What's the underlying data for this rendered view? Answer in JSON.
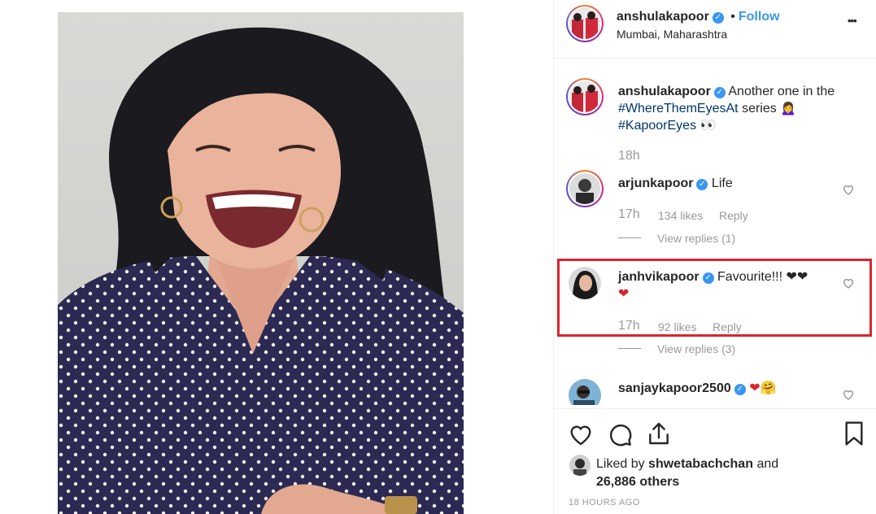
{
  "post": {
    "author": "anshulakapoor",
    "follow_label": "Follow",
    "separator": "•",
    "location": "Mumbai, Maharashtra",
    "more_label": "•••"
  },
  "caption": {
    "username": "anshulakapoor",
    "text_before": "Another one in the",
    "hashtag1": "#WhereThemEyesAt",
    "text_mid": "series 🙍‍♀️",
    "hashtag2": "#KapoorEyes",
    "text_after": "👀",
    "time": "18h"
  },
  "comments": [
    {
      "username": "arjunkapoor",
      "text": "Life",
      "time": "17h",
      "likes": "134 likes",
      "reply": "Reply",
      "view_replies": "View replies (1)"
    },
    {
      "username": "janhvikapoor",
      "text": "Favourite!!! ❤❤",
      "text2": "❤",
      "time": "17h",
      "likes": "92 likes",
      "reply": "Reply",
      "view_replies": "View replies (3)"
    },
    {
      "username": "sanjaykapoor2500",
      "text": "❤🤗"
    }
  ],
  "likes": {
    "prefix": "Liked by",
    "user": "shwetabachchan",
    "and": "and",
    "count": "26,886 others"
  },
  "posted_time": "18 HOURS AGO",
  "colors": {
    "accent": "#3897f0",
    "highlight": "#d9262c",
    "muted": "#999999",
    "text": "#262626"
  }
}
